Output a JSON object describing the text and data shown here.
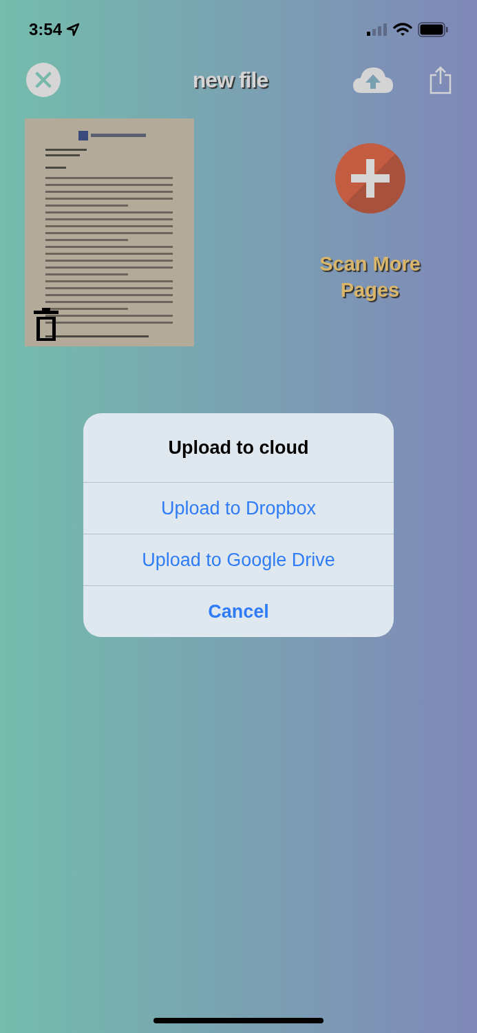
{
  "status_bar": {
    "time": "3:54"
  },
  "nav": {
    "title": "new file"
  },
  "scan_more": {
    "label": "Scan More Pages"
  },
  "dialog": {
    "title": "Upload to cloud",
    "actions": [
      {
        "label": "Upload to Dropbox",
        "kind": "default"
      },
      {
        "label": "Upload to Google Drive",
        "kind": "default"
      },
      {
        "label": "Cancel",
        "kind": "cancel"
      }
    ]
  }
}
